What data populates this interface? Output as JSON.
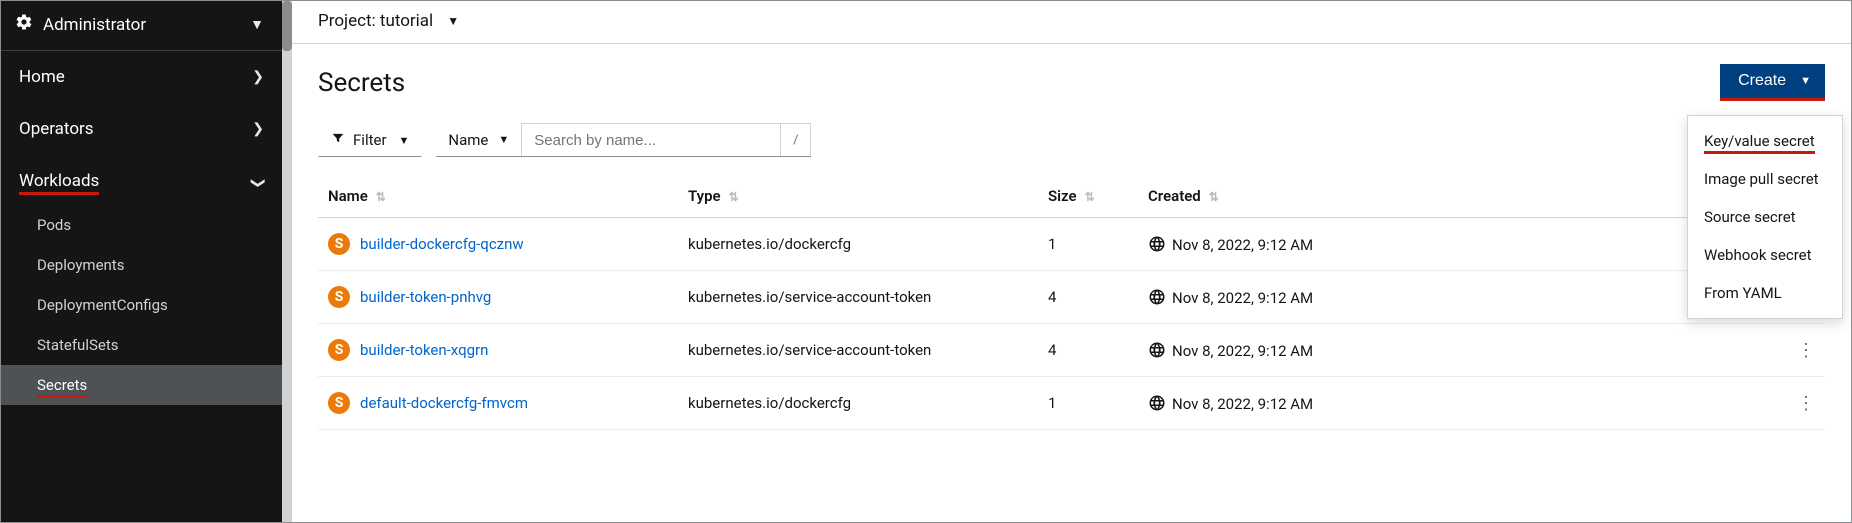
{
  "sidebar": {
    "perspective": "Administrator",
    "items": [
      {
        "label": "Home"
      },
      {
        "label": "Operators"
      },
      {
        "label": "Workloads"
      }
    ],
    "workloadsChildren": [
      {
        "label": "Pods"
      },
      {
        "label": "Deployments"
      },
      {
        "label": "DeploymentConfigs"
      },
      {
        "label": "StatefulSets"
      },
      {
        "label": "Secrets"
      }
    ]
  },
  "projectBar": {
    "label": "Project: tutorial"
  },
  "page": {
    "title": "Secrets"
  },
  "toolbar": {
    "filterLabel": "Filter",
    "searchTypeLabel": "Name",
    "searchPlaceholder": "Search by name...",
    "slash": "/"
  },
  "createButton": {
    "label": "Create"
  },
  "createMenu": {
    "items": [
      {
        "label": "Key/value secret"
      },
      {
        "label": "Image pull secret"
      },
      {
        "label": "Source secret"
      },
      {
        "label": "Webhook secret"
      },
      {
        "label": "From YAML"
      }
    ]
  },
  "table": {
    "columns": {
      "name": "Name",
      "type": "Type",
      "size": "Size",
      "created": "Created"
    },
    "badgeLetter": "S",
    "rows": [
      {
        "name": "builder-dockercfg-qcznw",
        "type": "kubernetes.io/dockercfg",
        "size": "1",
        "created": "Nov 8, 2022, 9:12 AM"
      },
      {
        "name": "builder-token-pnhvg",
        "type": "kubernetes.io/service-account-token",
        "size": "4",
        "created": "Nov 8, 2022, 9:12 AM"
      },
      {
        "name": "builder-token-xqgrn",
        "type": "kubernetes.io/service-account-token",
        "size": "4",
        "created": "Nov 8, 2022, 9:12 AM"
      },
      {
        "name": "default-dockercfg-fmvcm",
        "type": "kubernetes.io/dockercfg",
        "size": "1",
        "created": "Nov 8, 2022, 9:12 AM"
      }
    ]
  }
}
